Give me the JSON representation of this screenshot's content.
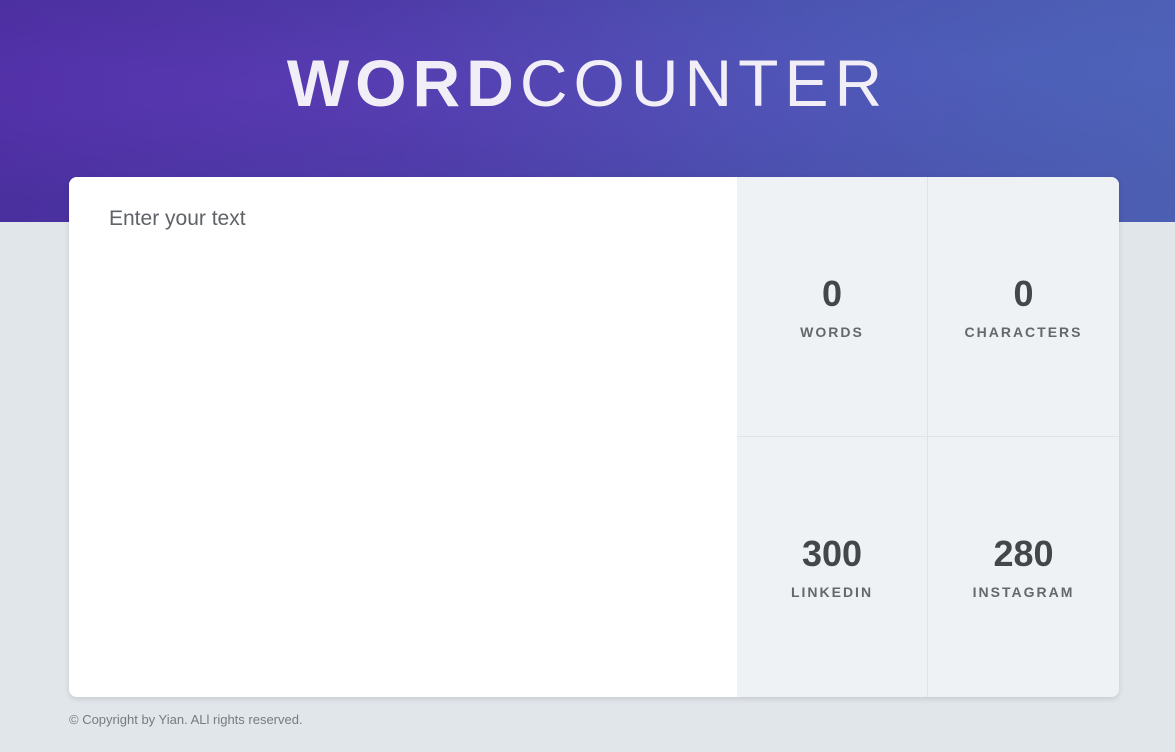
{
  "header": {
    "logo_bold": "WORD",
    "logo_light": "COUNTER"
  },
  "editor": {
    "placeholder": "Enter your text",
    "value": ""
  },
  "stats": [
    {
      "value": "0",
      "label": "WORDS"
    },
    {
      "value": "0",
      "label": "CHARACTERS"
    },
    {
      "value": "300",
      "label": "LINKEDIN"
    },
    {
      "value": "280",
      "label": "INSTAGRAM"
    }
  ],
  "footer": {
    "copyright": "© Copyright by Yian. ALl rights reserved."
  },
  "colors": {
    "hero_start": "#4a2e9e",
    "hero_end": "#4c5fb2",
    "background": "#e1e6ea",
    "stats_panel": "#eff2f5"
  }
}
